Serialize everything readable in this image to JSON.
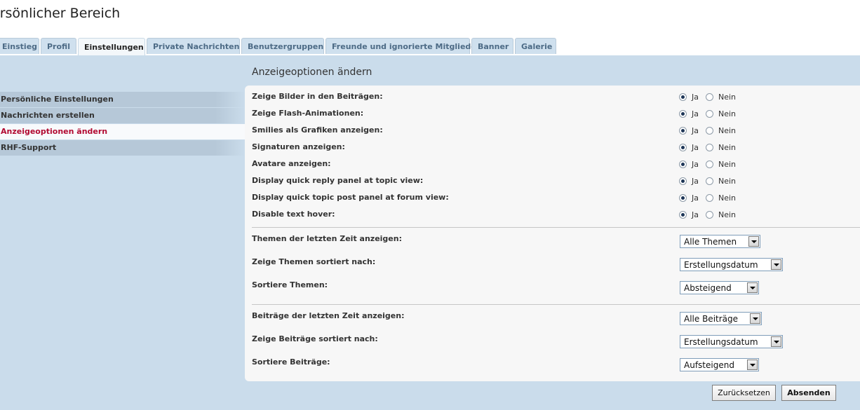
{
  "page_title": "ersönlicher Bereich",
  "tabs": [
    {
      "label": "Einstieg"
    },
    {
      "label": "Profil"
    },
    {
      "label": "Einstellungen"
    },
    {
      "label": "Private Nachrichten"
    },
    {
      "label": "Benutzergruppen"
    },
    {
      "label": "Freunde und ignorierte Mitglieder"
    },
    {
      "label": "Banner"
    },
    {
      "label": "Galerie"
    }
  ],
  "active_tab": "Einstellungen",
  "sidebar": {
    "items": [
      {
        "label": "Persönliche Einstellungen"
      },
      {
        "label": "Nachrichten erstellen"
      },
      {
        "label": "Anzeigeoptionen ändern"
      },
      {
        "label": "RHF-Support"
      }
    ],
    "active_item": "Anzeigeoptionen ändern"
  },
  "panel": {
    "title": "Anzeigeoptionen ändern",
    "yes_label": "Ja",
    "no_label": "Nein",
    "options": [
      {
        "label": "Zeige Bilder in den Beiträgen:",
        "selected": "Ja"
      },
      {
        "label": "Zeige Flash-Animationen:",
        "selected": "Ja"
      },
      {
        "label": "Smilies als Grafiken anzeigen:",
        "selected": "Ja"
      },
      {
        "label": "Signaturen anzeigen:",
        "selected": "Ja"
      },
      {
        "label": "Avatare anzeigen:",
        "selected": "Ja"
      },
      {
        "label": "Display quick reply panel at topic view:",
        "selected": "Ja"
      },
      {
        "label": "Display quick topic post panel at forum view:",
        "selected": "Ja"
      },
      {
        "label": "Disable text hover:",
        "selected": "Ja",
        "highlighted": true
      }
    ],
    "topic_settings": [
      {
        "label": "Themen der letzten Zeit anzeigen:",
        "value": "Alle Themen"
      },
      {
        "label": "Zeige Themen sortiert nach:",
        "value": "Erstellungsdatum"
      },
      {
        "label": "Sortiere Themen:",
        "value": "Absteigend"
      }
    ],
    "post_settings": [
      {
        "label": "Beiträge der letzten Zeit anzeigen:",
        "value": "Alle Beiträge"
      },
      {
        "label": "Zeige Beiträge sortiert nach:",
        "value": "Erstellungsdatum"
      },
      {
        "label": "Sortiere Beiträge:",
        "value": "Aufsteigend"
      }
    ]
  },
  "buttons": {
    "reset_label": "Zurücksetzen",
    "submit_label": "Absenden"
  },
  "colors": {
    "highlight": "#f7f706",
    "active_menu_text": "#b20b32",
    "tab_background": "#cfe0ee",
    "content_background": "#cadceb"
  }
}
